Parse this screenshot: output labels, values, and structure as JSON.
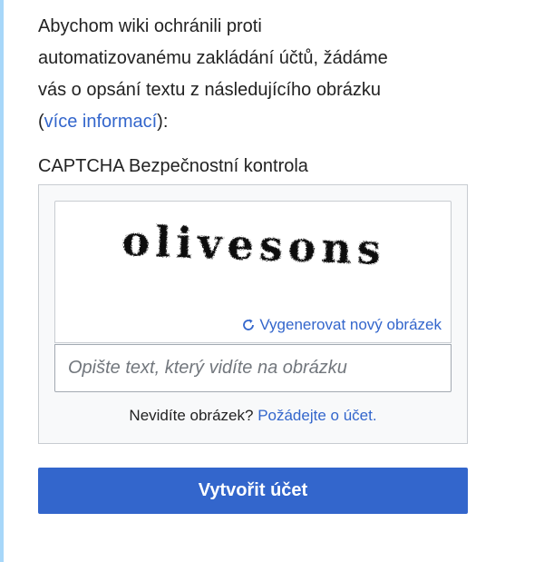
{
  "intro": {
    "line1": "Abychom wiki ochránili proti",
    "line2": "automatizovanému zakládání účtů, žádáme",
    "line3": "vás o opsání textu z následujícího obrázku",
    "paren_open": "(",
    "more_info_link": "více informací",
    "paren_close": "):"
  },
  "captcha": {
    "heading": "CAPTCHA Bezpečnostní kontrola",
    "image_text": "olivesons",
    "refresh_label": "Vygenerovat nový obrázek",
    "refresh_icon": "refresh-icon",
    "input_value": "",
    "input_placeholder": "Opište text, který vidíte na obrázku",
    "no_image_prefix": "Nevidíte obrázek?",
    "request_account_link": "Požádejte o účet."
  },
  "form": {
    "submit_label": "Vytvořit účet"
  },
  "colors": {
    "link": "#3366cc",
    "button_bg": "#3366cc",
    "button_text": "#ffffff",
    "box_bg": "#f8f9fa",
    "box_border": "#c8ccd1",
    "left_rule": "#a7d7f9",
    "text": "#222222",
    "placeholder": "#72777d"
  }
}
